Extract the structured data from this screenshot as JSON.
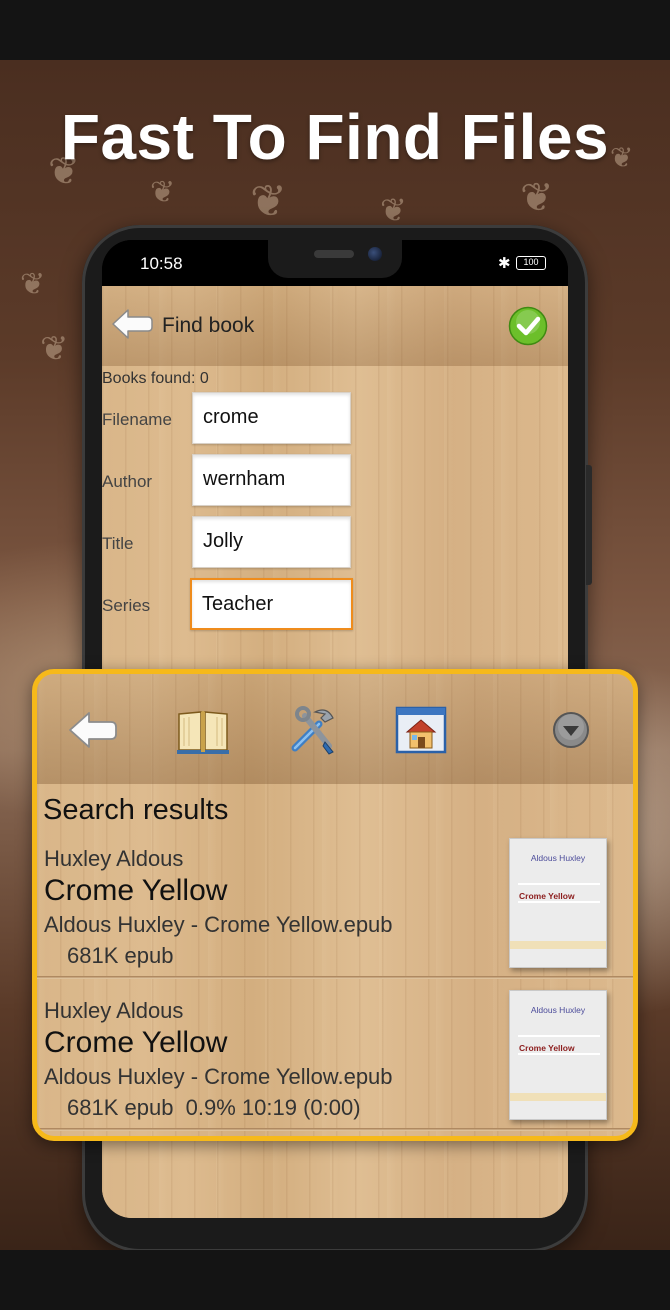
{
  "promo": {
    "headline": "Fast To Find Files"
  },
  "status_bar": {
    "time": "10:58",
    "battery": "100"
  },
  "find_book": {
    "title": "Find book",
    "books_found": "Books found: 0",
    "fields": {
      "filename": {
        "label": "Filename",
        "value": "crome"
      },
      "author": {
        "label": "Author",
        "value": "wernham"
      },
      "title": {
        "label": "Title",
        "value": "Jolly"
      },
      "series": {
        "label": "Series",
        "value": "Teacher"
      }
    }
  },
  "toolbar": {
    "buttons": [
      "back-icon",
      "open-book-icon",
      "tools-icon",
      "home-icon",
      "dropdown-icon"
    ]
  },
  "search_results": {
    "heading": "Search results",
    "items": [
      {
        "author": "Huxley Aldous",
        "title": "Crome Yellow",
        "filename": "Aldous Huxley - Crome Yellow.epub",
        "info": "681K epub",
        "cover_author": "Aldous Huxley",
        "cover_title": "Crome Yellow"
      },
      {
        "author": "Huxley Aldous",
        "title": "Crome Yellow",
        "filename": "Aldous Huxley - Crome Yellow.epub",
        "info": "681K epub  0.9% 10:19 (0:00)",
        "cover_author": "Aldous Huxley",
        "cover_title": "Crome Yellow"
      }
    ]
  },
  "colors": {
    "accent_orange": "#f6b91a",
    "focus_orange": "#ef8c1c",
    "confirm_green": "#6cbf2a"
  }
}
